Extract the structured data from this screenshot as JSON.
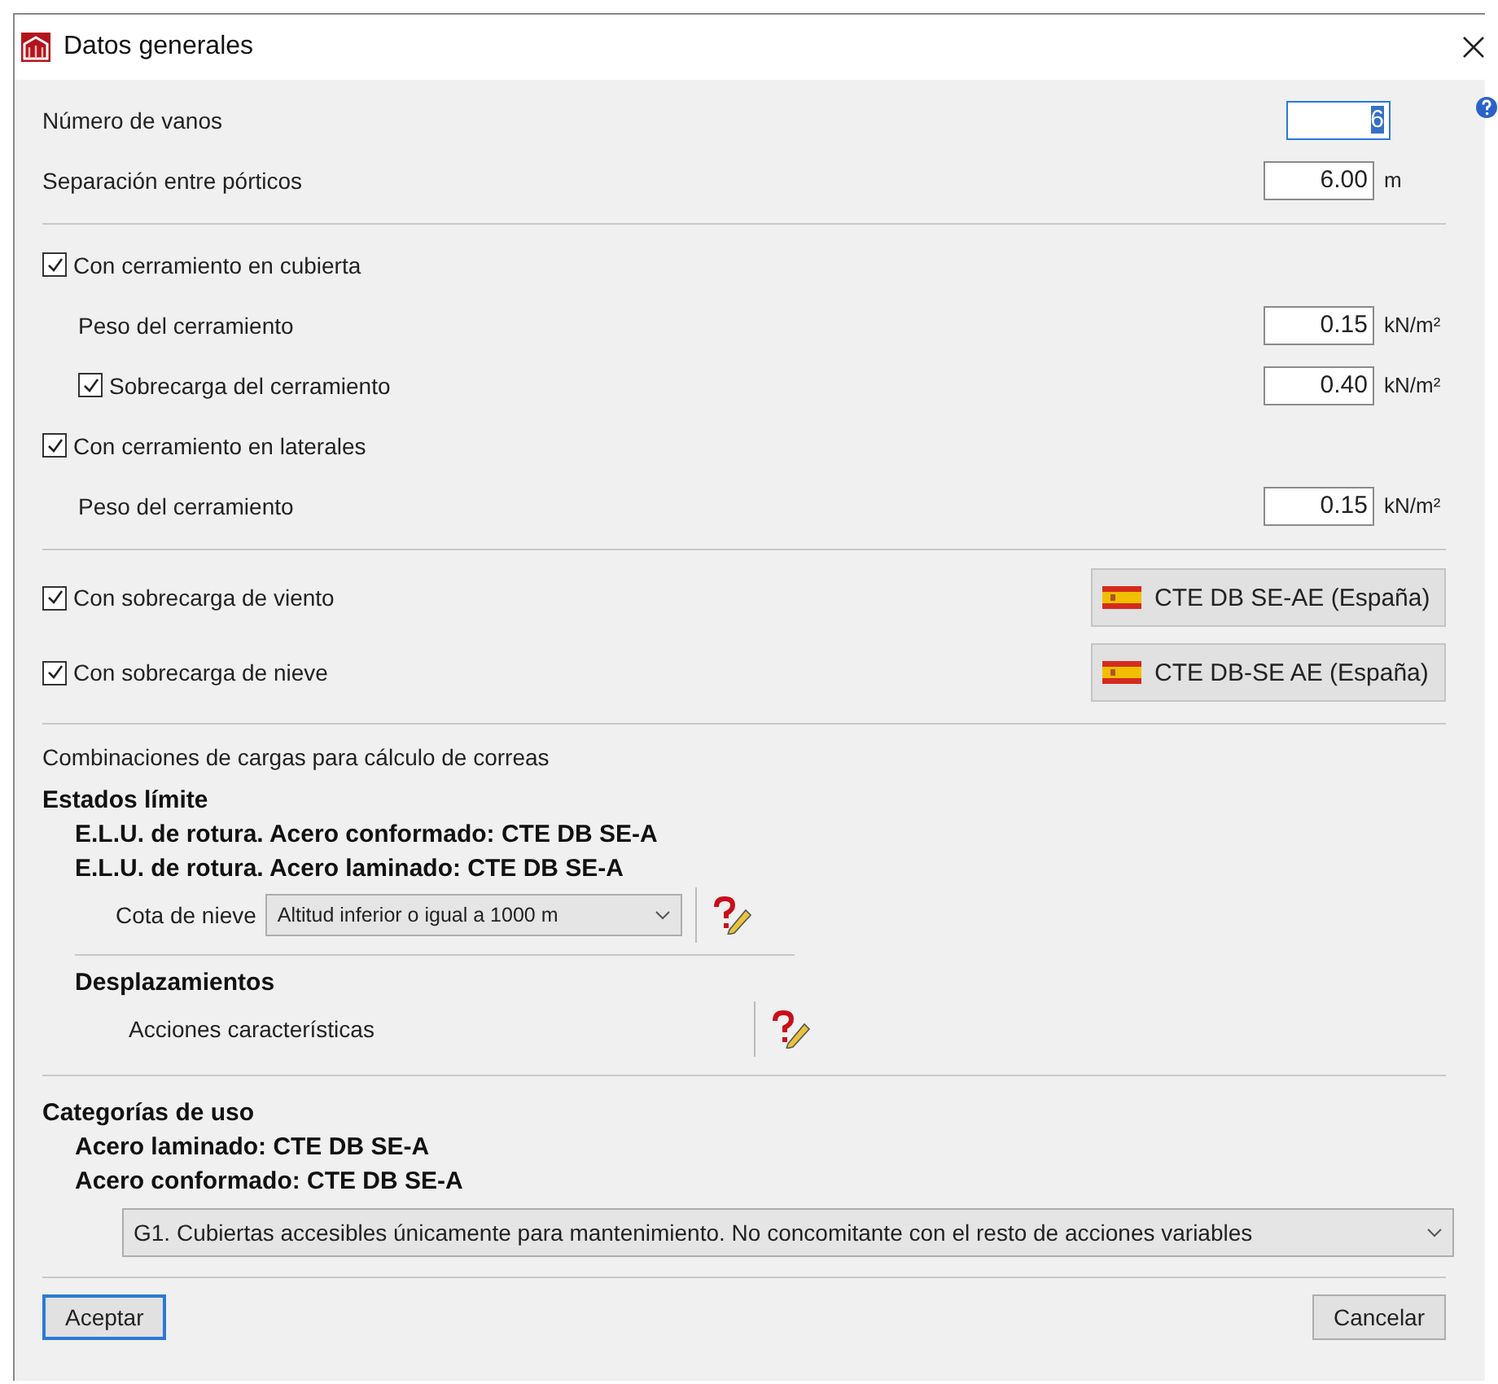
{
  "window": {
    "title": "Datos generales"
  },
  "sections": [
    {
      "rows": [
        {
          "kind": "input",
          "label": "Número de vanos",
          "value": "6",
          "focused": true
        },
        {
          "kind": "input",
          "label": "Separación entre pórticos",
          "value": "6.00",
          "unit": "m",
          "focused": false
        }
      ]
    },
    {
      "rows": [
        {
          "kind": "check",
          "label": "Con cerramiento en cubierta",
          "checked": true,
          "children": [
            {
              "kind": "input",
              "label": "Peso del cerramiento",
              "value": "0.15",
              "unit": "kN/m²"
            },
            {
              "kind": "check",
              "label": "Sobrecarga del cerramiento",
              "checked": true,
              "value": "0.40",
              "unit": "kN/m²"
            }
          ]
        },
        {
          "kind": "check",
          "label": "Con cerramiento en laterales",
          "checked": true,
          "children": [
            {
              "kind": "input",
              "label": "Peso del cerramiento",
              "value": "0.15",
              "unit": "kN/m²"
            }
          ]
        }
      ]
    },
    {
      "rows": [
        {
          "kind": "norm",
          "label": "Con sobrecarga de viento",
          "checked": true,
          "button": "CTE DB SE-AE (España)"
        },
        {
          "kind": "norm",
          "label": "Con sobrecarga de nieve",
          "checked": true,
          "button": "CTE DB-SE AE (España)"
        }
      ]
    }
  ],
  "combinations": {
    "title": "Combinaciones de cargas para cálculo de correas",
    "heading": "Estados límite",
    "lines": [
      "E.L.U. de rotura. Acero conformado: CTE DB SE-A",
      "E.L.U. de rotura. Acero laminado: CTE DB SE-A"
    ],
    "select": {
      "label": "Cota de nieve",
      "value": "Altitud inferior o igual a 1000 m"
    },
    "subheading": "Desplazamientos",
    "item": "Acciones características"
  },
  "usage": {
    "heading": "Categorías de uso",
    "lines": [
      "Acero laminado: CTE DB SE-A",
      "Acero conformado: CTE DB SE-A"
    ],
    "select": "G1. Cubiertas accesibles únicamente para mantenimiento. No concomitante con el resto de acciones variables"
  },
  "buttons": {
    "ok": "Aceptar",
    "cancel": "Cancelar"
  }
}
